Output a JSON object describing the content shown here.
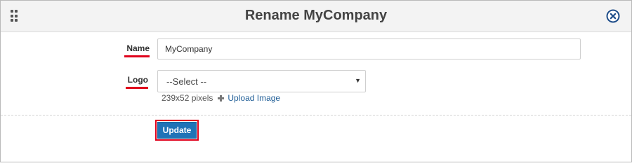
{
  "dialog": {
    "title": "Rename MyCompany",
    "close_icon": "close-circle-icon",
    "drag_icon": "drag-handle-icon"
  },
  "form": {
    "name": {
      "label": "Name",
      "value": "MyCompany"
    },
    "logo": {
      "label": "Logo",
      "selected": "--Select --",
      "hint": "239x52 pixels",
      "upload_label": "Upload Image"
    },
    "update_label": "Update"
  },
  "colors": {
    "highlight": "#e0001b",
    "primary_button": "#1f73b7",
    "link": "#1f5d96"
  }
}
